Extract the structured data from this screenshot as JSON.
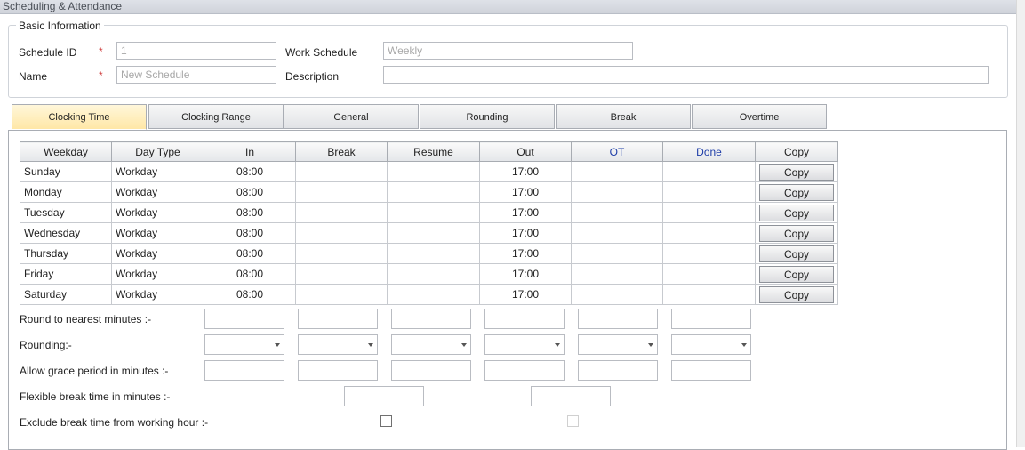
{
  "window": {
    "title": "Scheduling & Attendance"
  },
  "basic_info": {
    "legend": "Basic Information",
    "schedule_id": {
      "label": "Schedule ID",
      "required_mark": "*",
      "value": "1"
    },
    "name": {
      "label": "Name",
      "required_mark": "*",
      "placeholder": "New Schedule"
    },
    "work_schedule": {
      "label": "Work Schedule",
      "value": "Weekly"
    },
    "description": {
      "label": "Description",
      "value": ""
    }
  },
  "tabs": [
    {
      "label": "Clocking Time",
      "active": true
    },
    {
      "label": "Clocking Range"
    },
    {
      "label": "General"
    },
    {
      "label": "Rounding"
    },
    {
      "label": "Break"
    },
    {
      "label": "Overtime"
    }
  ],
  "grid": {
    "columns": [
      "Weekday",
      "Day Type",
      "In",
      "Break",
      "Resume",
      "Out",
      "OT",
      "Done",
      "Copy"
    ],
    "rows": [
      {
        "weekday": "Sunday",
        "day_type": "Workday",
        "in": "08:00",
        "break": "",
        "resume": "",
        "out": "17:00",
        "ot": "",
        "done": "",
        "copy": "Copy"
      },
      {
        "weekday": "Monday",
        "day_type": "Workday",
        "in": "08:00",
        "break": "",
        "resume": "",
        "out": "17:00",
        "ot": "",
        "done": "",
        "copy": "Copy"
      },
      {
        "weekday": "Tuesday",
        "day_type": "Workday",
        "in": "08:00",
        "break": "",
        "resume": "",
        "out": "17:00",
        "ot": "",
        "done": "",
        "copy": "Copy"
      },
      {
        "weekday": "Wednesday",
        "day_type": "Workday",
        "in": "08:00",
        "break": "",
        "resume": "",
        "out": "17:00",
        "ot": "",
        "done": "",
        "copy": "Copy"
      },
      {
        "weekday": "Thursday",
        "day_type": "Workday",
        "in": "08:00",
        "break": "",
        "resume": "",
        "out": "17:00",
        "ot": "",
        "done": "",
        "copy": "Copy"
      },
      {
        "weekday": "Friday",
        "day_type": "Workday",
        "in": "08:00",
        "break": "",
        "resume": "",
        "out": "17:00",
        "ot": "",
        "done": "",
        "copy": "Copy"
      },
      {
        "weekday": "Saturday",
        "day_type": "Workday",
        "in": "08:00",
        "break": "",
        "resume": "",
        "out": "17:00",
        "ot": "",
        "done": "",
        "copy": "Copy"
      }
    ]
  },
  "settings": {
    "round_label": "Round to nearest minutes :-",
    "rounding_label": "Rounding:-",
    "grace_label": "Allow grace period in minutes :-",
    "flex_label": "Flexible break time in minutes :-",
    "exclude_label": "Exclude break time from working hour :-"
  },
  "colors": {
    "active_tab": "#ffe7a6",
    "header_blue": "#1e3da8",
    "required": "#d04040"
  }
}
